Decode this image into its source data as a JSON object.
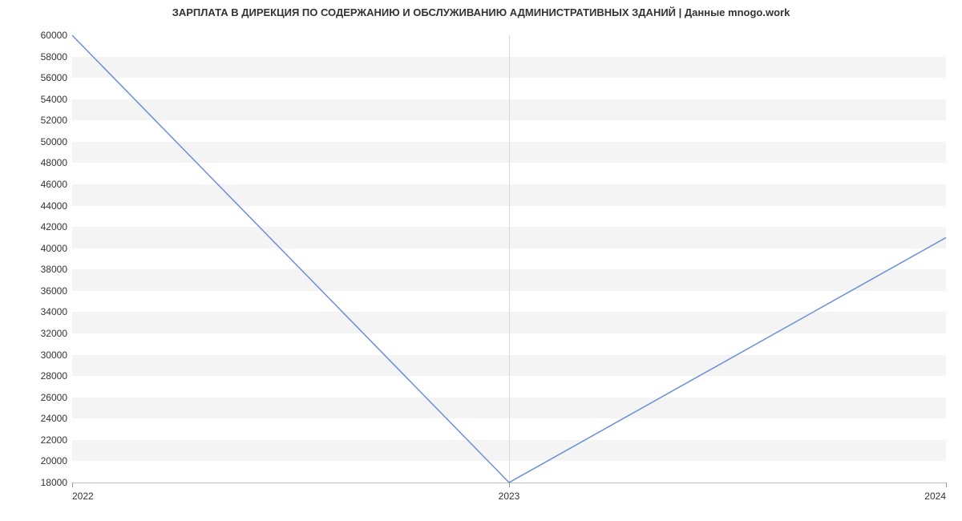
{
  "chart_data": {
    "type": "line",
    "title": "ЗАРПЛАТА В ДИРЕКЦИЯ ПО СОДЕРЖАНИЮ И ОБСЛУЖИВАНИЮ АДМИНИСТРАТИВНЫХ ЗДАНИЙ | Данные mnogo.work",
    "x_categories": [
      "2022",
      "2023",
      "2024"
    ],
    "x_positions": [
      0,
      1,
      2
    ],
    "values": [
      60000,
      18000,
      41000
    ],
    "y_ticks": [
      18000,
      20000,
      22000,
      24000,
      26000,
      28000,
      30000,
      32000,
      34000,
      36000,
      38000,
      40000,
      42000,
      44000,
      46000,
      48000,
      50000,
      52000,
      54000,
      56000,
      58000,
      60000
    ],
    "ylim": [
      18000,
      60000
    ],
    "xlim": [
      0,
      2
    ],
    "xlabel": "",
    "ylabel": "",
    "line_color": "#6a8fd8"
  }
}
